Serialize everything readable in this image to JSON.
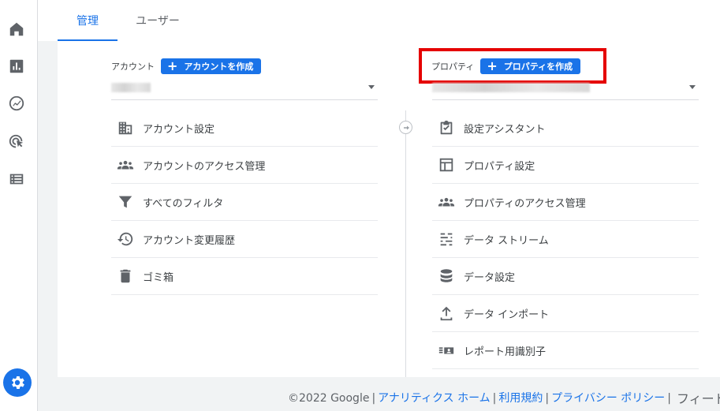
{
  "tabs": [
    {
      "label": "管理",
      "active": true
    },
    {
      "label": "ユーザー",
      "active": false
    }
  ],
  "sidenav": [
    {
      "name": "home-icon"
    },
    {
      "name": "reports-icon"
    },
    {
      "name": "explore-icon"
    },
    {
      "name": "advertising-icon"
    },
    {
      "name": "configure-icon"
    }
  ],
  "account": {
    "label": "アカウント",
    "create_button": "アカウントを作成",
    "menu": [
      {
        "label": "アカウント設定",
        "icon": "building-icon"
      },
      {
        "label": "アカウントのアクセス管理",
        "icon": "people-icon"
      },
      {
        "label": "すべてのフィルタ",
        "icon": "filter-icon"
      },
      {
        "label": "アカウント変更履歴",
        "icon": "history-icon"
      },
      {
        "label": "ゴミ箱",
        "icon": "trash-icon"
      }
    ]
  },
  "property": {
    "label": "プロパティ",
    "create_button": "プロパティを作成",
    "menu": [
      {
        "label": "設定アシスタント",
        "icon": "clipboard-check-icon"
      },
      {
        "label": "プロパティ設定",
        "icon": "layout-icon"
      },
      {
        "label": "プロパティのアクセス管理",
        "icon": "people-icon"
      },
      {
        "label": "データ ストリーム",
        "icon": "streams-icon"
      },
      {
        "label": "データ設定",
        "icon": "database-icon"
      },
      {
        "label": "データ インポート",
        "icon": "upload-icon"
      },
      {
        "label": "レポート用識別子",
        "icon": "identity-icon"
      }
    ]
  },
  "footer": {
    "copyright": "©2022 Google",
    "links": [
      "アナリティクス ホーム",
      "利用規約",
      "プライバシー ポリシー"
    ],
    "feedback": "フィード"
  },
  "colors": {
    "accent": "#1a73e8",
    "highlight": "#e50000"
  }
}
